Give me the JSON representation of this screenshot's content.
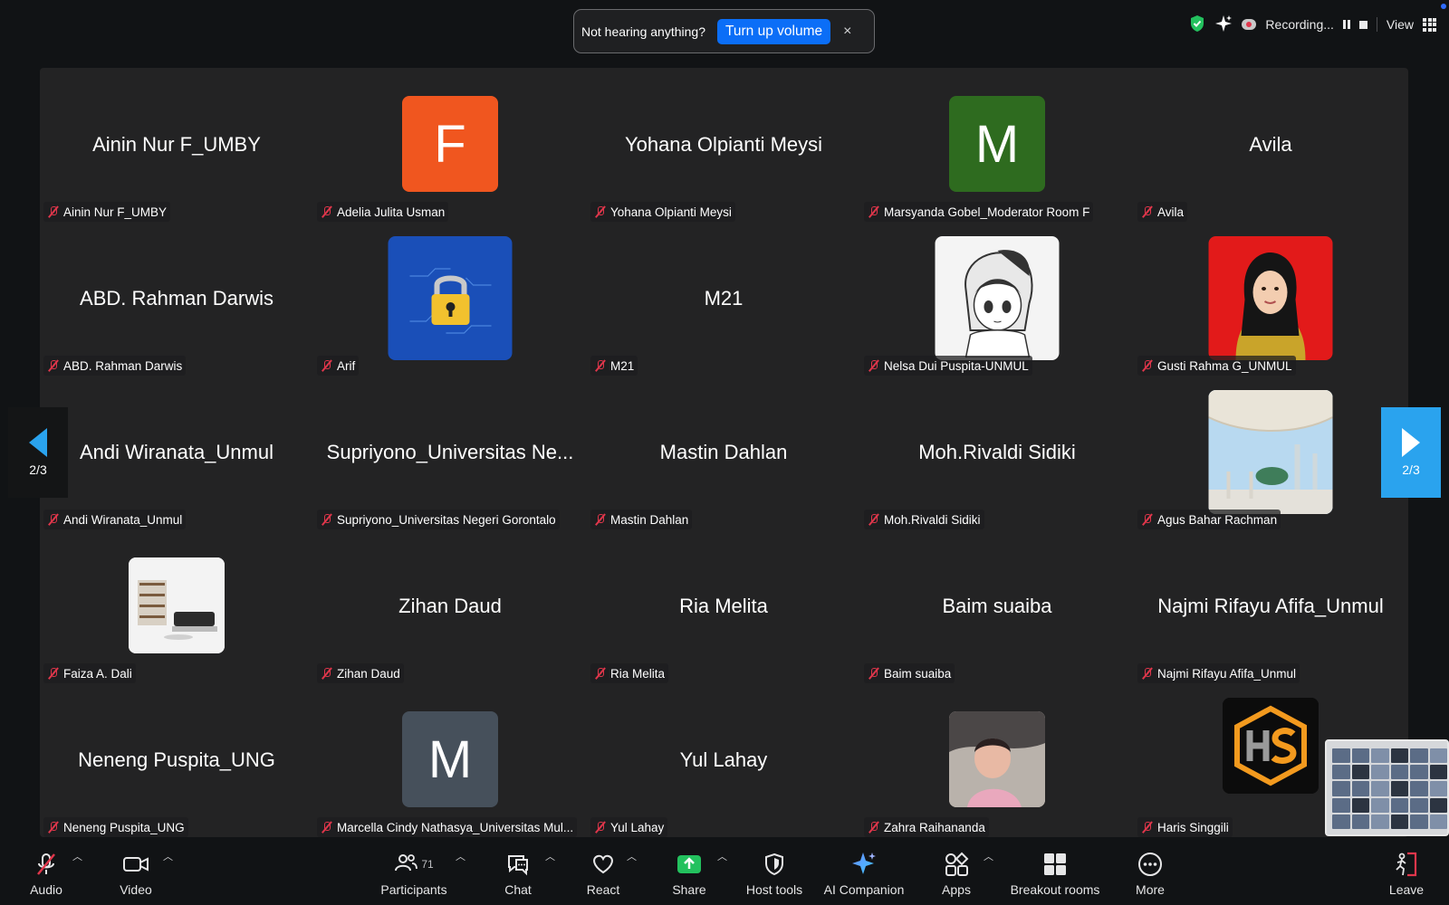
{
  "notice": {
    "text": "Not hearing anything?",
    "button_label": "Turn up volume",
    "close_glyph": "×"
  },
  "status_bar": {
    "recording_label": "Recording...",
    "view_label": "View"
  },
  "gallery": {
    "page_indicator_left": "2/3",
    "page_indicator_right": "2/3",
    "tiles": [
      {
        "display": "Ainin Nur F_UMBY",
        "label": "Ainin Nur F_UMBY"
      },
      {
        "display": "F",
        "label": "Adelia Julita Usman",
        "avatar_color": "#f0561f"
      },
      {
        "display": "Yohana Olpianti Meysi",
        "label": "Yohana Olpianti Meysi"
      },
      {
        "display": "M",
        "label": "Marsyanda Gobel_Moderator Room F",
        "avatar_color": "#2e6b1f"
      },
      {
        "display": "Avila",
        "label": "Avila"
      },
      {
        "display": "ABD. Rahman Darwis",
        "label": "ABD. Rahman Darwis"
      },
      {
        "display": "",
        "label": "Arif",
        "avatar": "padlock-image"
      },
      {
        "display": "M21",
        "label": "M21"
      },
      {
        "display": "",
        "label": "Nelsa Dui Puspita-UNMUL",
        "avatar": "anime-drawing-image"
      },
      {
        "display": "",
        "label": "Gusti Rahma G_UNMUL",
        "avatar": "portrait-photo"
      },
      {
        "display": "Andi Wiranata_Unmul",
        "label": "Andi Wiranata_Unmul"
      },
      {
        "display": "Supriyono_Universitas Ne...",
        "label": "Supriyono_Universitas Negeri Gorontalo"
      },
      {
        "display": "Mastin Dahlan",
        "label": "Mastin Dahlan"
      },
      {
        "display": "Moh.Rivaldi Sidiki",
        "label": "Moh.Rivaldi Sidiki"
      },
      {
        "display": "",
        "label": "Agus Bahar Rachman",
        "avatar": "mosque-photo"
      },
      {
        "display": "",
        "label": "Faiza A. Dali",
        "avatar": "room-photo"
      },
      {
        "display": "Zihan Daud",
        "label": "Zihan Daud"
      },
      {
        "display": "Ria Melita",
        "label": "Ria Melita"
      },
      {
        "display": "Baim suaiba",
        "label": "Baim suaiba"
      },
      {
        "display": "Najmi Rifayu Afifa_Unmul",
        "label": "Najmi Rifayu Afifa_Unmul"
      },
      {
        "display": "Neneng Puspita_UNG",
        "label": "Neneng Puspita_UNG"
      },
      {
        "display": "M",
        "label": "Marcella Cindy Nathasya_Universitas Mul...",
        "avatar_color": "#46505b"
      },
      {
        "display": "Yul Lahay",
        "label": "Yul Lahay"
      },
      {
        "display": "",
        "label": "Zahra Raihananda",
        "avatar": "child-photo"
      },
      {
        "display": "",
        "label": "Haris Singgili",
        "avatar": "hs-logo"
      }
    ]
  },
  "toolbar": {
    "audio": "Audio",
    "video": "Video",
    "participants": "Participants",
    "participants_count": "71",
    "chat": "Chat",
    "react": "React",
    "share": "Share",
    "host_tools": "Host tools",
    "ai_companion": "AI Companion",
    "apps": "Apps",
    "breakout_rooms": "Breakout rooms",
    "more": "More",
    "leave": "Leave"
  },
  "colors": {
    "accent_blue": "#0b6ef7",
    "share_green": "#23c15e",
    "muted_red": "#e0364b",
    "pager_blue": "#2aa3ee"
  }
}
